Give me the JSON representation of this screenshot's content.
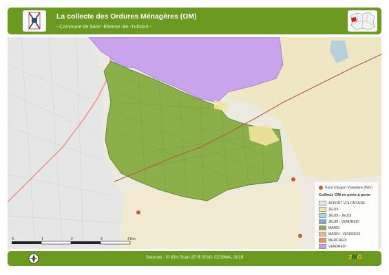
{
  "header": {
    "title": "La collecte des Ordures Ménagères (OM)",
    "subtitle": "- Commune de Saint -Étienne -de -Tulmont -",
    "logo_icon": "municipal-crest-icon",
    "locator_icon": "locator-map-icon"
  },
  "legend": {
    "point_label": "Point d'Apport Volontaire (PAV)",
    "section_title": "Collecte OM en porte à porte",
    "items": [
      {
        "label": "APPORT VOLONTAIRE",
        "color": "#e6e6e6"
      },
      {
        "label": "JEUDI",
        "color": "#f2e6a0"
      },
      {
        "label": "JEUDI - JEUDI",
        "color": "#a8d8e8"
      },
      {
        "label": "JEUDI - VENDREDI",
        "color": "#7fa6d9"
      },
      {
        "label": "MARDI",
        "color": "#8bb04a"
      },
      {
        "label": "MARDI - VENDREDI",
        "color": "#f3b38c"
      },
      {
        "label": "MERCREDI",
        "color": "#e8924a"
      },
      {
        "label": "VENDREDI",
        "color": "#c79ae8"
      }
    ]
  },
  "scale": {
    "ticks": [
      "0",
      "1",
      "2",
      "3",
      "4 Km"
    ]
  },
  "footer": {
    "sources": "Sources : © IGN Scan 25 ® 2010; CCGMA, 2019",
    "brand_left": "3",
    "brand_mid": "M",
    "brand_right": "G",
    "compass_icon": "compass-rose-icon"
  },
  "colors": {
    "banner": "#6a9a1f",
    "mardi_zone": "#8bb04a",
    "vendredi_zone": "#c79ae8"
  }
}
